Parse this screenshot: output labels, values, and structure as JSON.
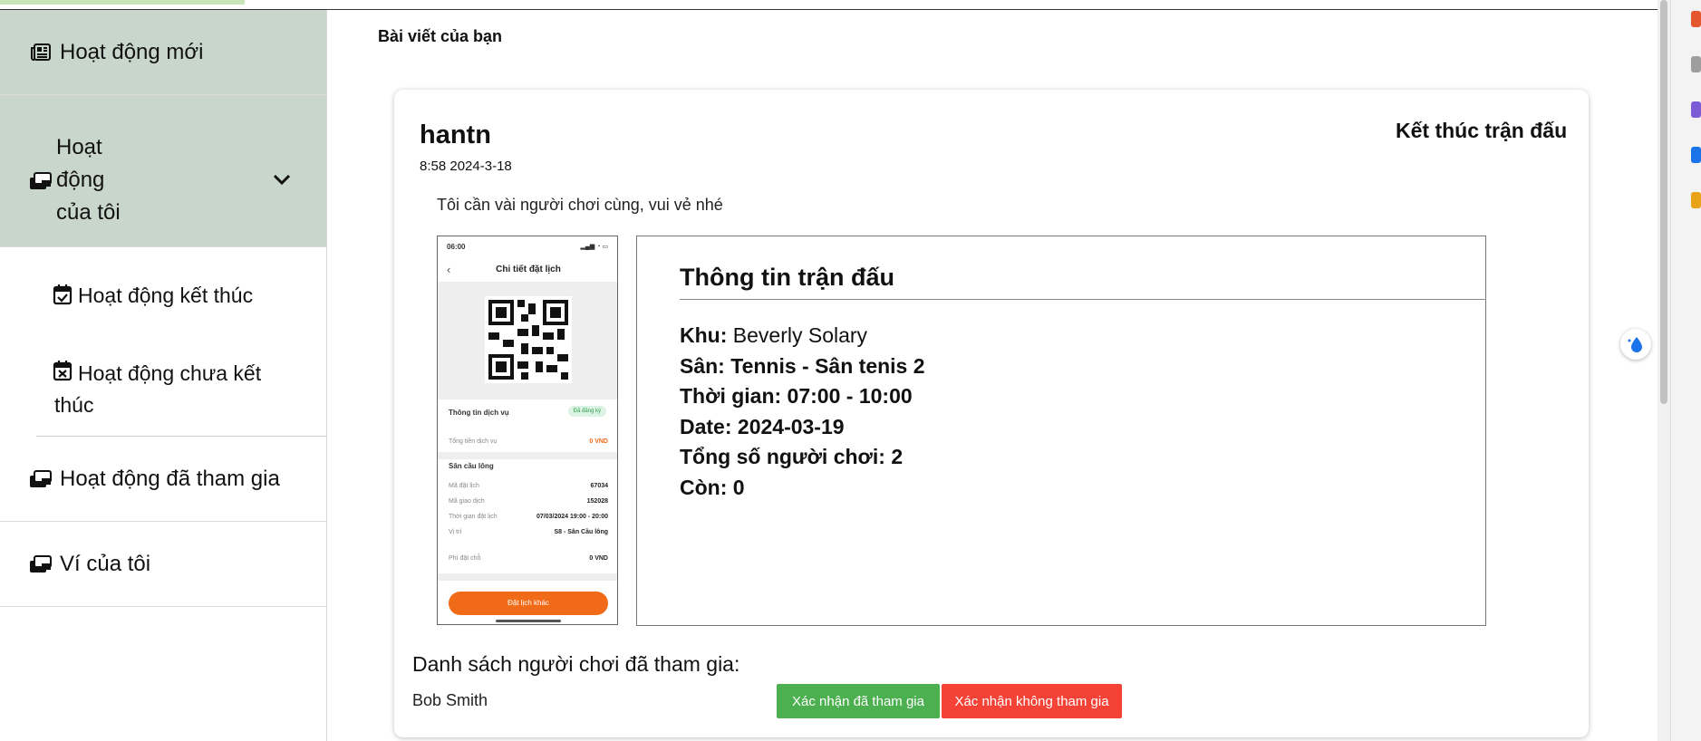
{
  "sidebar": {
    "items": [
      {
        "label": "Hoạt động mới",
        "icon": "newspaper-icon"
      },
      {
        "label_lines": [
          "Hoạt",
          "động",
          "của tôi"
        ],
        "icon": "ticket-icon",
        "expanded": true
      },
      {
        "label": "Hoạt động kết thúc",
        "icon": "calendar-check-icon"
      },
      {
        "label": "Hoạt động chưa kết thúc",
        "icon": "calendar-x-icon"
      },
      {
        "label": "Hoạt động đã tham gia",
        "icon": "ticket-icon"
      },
      {
        "label": "Ví của tôi",
        "icon": "ticket-icon"
      }
    ]
  },
  "main": {
    "section_title": "Bài viết của bạn",
    "post": {
      "author": "hantn",
      "time": "8:58 2024-3-18",
      "action_label": "Kết thúc trận đấu",
      "content": "Tôi cần vài người chơi cùng, vui vẻ nhé",
      "phone_screenshot": {
        "status_time": "06:00",
        "title": "Chi tiết đặt lịch",
        "info_label": "Thông tin dịch vụ",
        "badge": "Đã đăng ký",
        "total_label": "Tổng tiền dịch vụ",
        "total_value": "0 VND",
        "section": "Sân cầu lông",
        "rows": [
          {
            "k": "Mã đặt lịch",
            "v": "67034"
          },
          {
            "k": "Mã giao dịch",
            "v": "152028"
          },
          {
            "k": "Thời gian đặt lịch",
            "v": "07/03/2024 19:00 - 20:00"
          },
          {
            "k": "Vị trí",
            "v": "S8 - Sân Cầu lông"
          }
        ],
        "fee_label": "Phí đặt chỗ",
        "fee_value": "0 VND",
        "cta": "Đặt lịch khác"
      },
      "match_info": {
        "title": "Thông tin trận đấu",
        "area_label": "Khu:",
        "area_value": "Beverly Solary",
        "court": "Sân: Tennis - Sân tenis 2",
        "time": "Thời gian: 07:00 - 10:00",
        "date": "Date: 2024-03-19",
        "total_players": "Tổng số người chơi: 2",
        "remaining": "Còn: 0"
      },
      "players_title": "Danh sách người chơi đã tham gia:",
      "players": [
        {
          "name": "Bob Smith",
          "confirm_label": "Xác nhận đã tham gia",
          "reject_label": "Xác nhận không tham gia"
        }
      ]
    }
  },
  "colors": {
    "sidebar_active": "#c9d6cb",
    "confirm": "#4caf50",
    "reject": "#f44336",
    "phone_accent": "#f06a17"
  }
}
